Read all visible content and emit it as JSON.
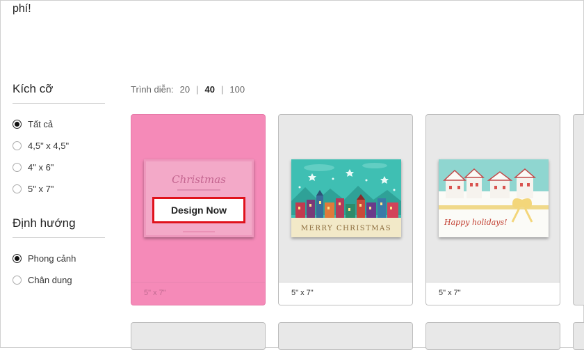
{
  "top_text": "phí!",
  "filters": {
    "size": {
      "title": "Kích cỡ",
      "options": [
        {
          "label": "Tất cả",
          "checked": true
        },
        {
          "label": "4,5\" x 4,5\"",
          "checked": false
        },
        {
          "label": "4\" x 6\"",
          "checked": false
        },
        {
          "label": "5\" x 7\"",
          "checked": false
        }
      ]
    },
    "orientation": {
      "title": "Định hướng",
      "options": [
        {
          "label": "Phong cảnh",
          "checked": true
        },
        {
          "label": "Chân dung",
          "checked": false
        }
      ]
    }
  },
  "show": {
    "label": "Trình diễn:",
    "options": [
      "20",
      "40",
      "100"
    ],
    "active": "40"
  },
  "cards": [
    {
      "caption": "5\" x 7\"",
      "design_label": "Design Now",
      "thumb_script": "Christmas"
    },
    {
      "caption": "5\" x 7\"",
      "thumb_text": "MERRY CHRISTMAS"
    },
    {
      "caption": "5\" x 7\"",
      "thumb_text": "Happy holidays!"
    }
  ],
  "colors": {
    "hover_pink": "#f58ab8",
    "button_border": "#e0121c",
    "teal_sky": "#3fbfb3",
    "cream": "#f2e9c8"
  }
}
